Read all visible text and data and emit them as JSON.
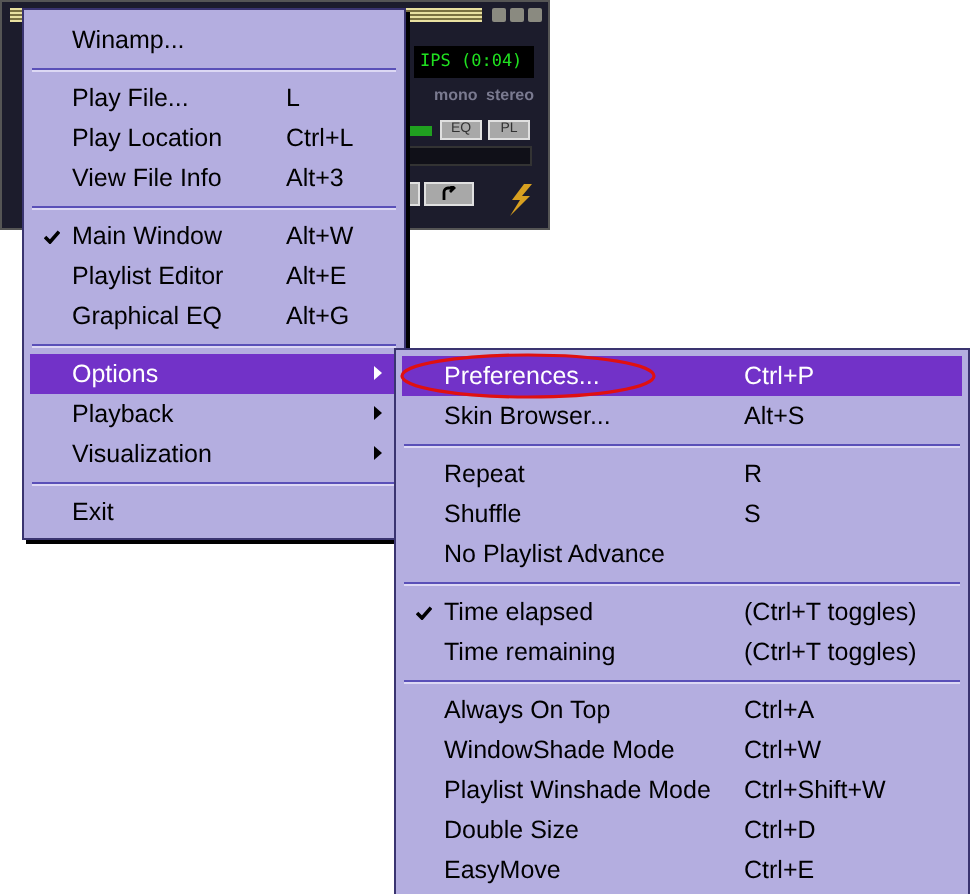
{
  "player": {
    "display": "IPS (0:04)",
    "mono": "mono",
    "stereo": "stereo",
    "eq_button": "EQ",
    "pl_button": "PL"
  },
  "menu": {
    "items": [
      {
        "kind": "item",
        "label": "Winamp...",
        "checked": false,
        "selected": false
      },
      {
        "kind": "separator"
      },
      {
        "kind": "item",
        "label": "Play File...",
        "shortcut": "L",
        "checked": false,
        "selected": false
      },
      {
        "kind": "item",
        "label": "Play Location",
        "shortcut": "Ctrl+L",
        "checked": false,
        "selected": false
      },
      {
        "kind": "item",
        "label": "View File Info",
        "shortcut": "Alt+3",
        "checked": false,
        "selected": false
      },
      {
        "kind": "separator"
      },
      {
        "kind": "item",
        "label": "Main Window",
        "shortcut": "Alt+W",
        "checked": true,
        "selected": false
      },
      {
        "kind": "item",
        "label": "Playlist Editor",
        "shortcut": "Alt+E",
        "checked": false,
        "selected": false
      },
      {
        "kind": "item",
        "label": "Graphical EQ",
        "shortcut": "Alt+G",
        "checked": false,
        "selected": false
      },
      {
        "kind": "separator"
      },
      {
        "kind": "submenu",
        "label": "Options",
        "checked": false,
        "selected": true
      },
      {
        "kind": "submenu",
        "label": "Playback",
        "checked": false,
        "selected": false
      },
      {
        "kind": "submenu",
        "label": "Visualization",
        "checked": false,
        "selected": false
      },
      {
        "kind": "separator"
      },
      {
        "kind": "item",
        "label": "Exit",
        "checked": false,
        "selected": false
      }
    ]
  },
  "submenu": {
    "items": [
      {
        "kind": "item",
        "label": "Preferences...",
        "shortcut": "Ctrl+P",
        "checked": false,
        "selected": true,
        "circled": true
      },
      {
        "kind": "item",
        "label": "Skin Browser...",
        "shortcut": "Alt+S",
        "checked": false,
        "selected": false,
        "circled": false
      },
      {
        "kind": "separator"
      },
      {
        "kind": "item",
        "label": "Repeat",
        "shortcut": "R",
        "checked": false,
        "selected": false,
        "circled": false
      },
      {
        "kind": "item",
        "label": "Shuffle",
        "shortcut": "S",
        "checked": false,
        "selected": false,
        "circled": false
      },
      {
        "kind": "item",
        "label": "No Playlist Advance",
        "checked": false,
        "selected": false,
        "circled": false
      },
      {
        "kind": "separator"
      },
      {
        "kind": "item",
        "label": "Time elapsed",
        "shortcut": "(Ctrl+T toggles)",
        "checked": true,
        "selected": false,
        "circled": false
      },
      {
        "kind": "item",
        "label": "Time remaining",
        "shortcut": "(Ctrl+T toggles)",
        "checked": false,
        "selected": false,
        "circled": false
      },
      {
        "kind": "separator"
      },
      {
        "kind": "item",
        "label": "Always On Top",
        "shortcut": "Ctrl+A",
        "checked": false,
        "selected": false,
        "circled": false
      },
      {
        "kind": "item",
        "label": "WindowShade Mode",
        "shortcut": "Ctrl+W",
        "checked": false,
        "selected": false,
        "circled": false
      },
      {
        "kind": "item",
        "label": "Playlist Winshade Mode",
        "shortcut": "Ctrl+Shift+W",
        "checked": false,
        "selected": false,
        "circled": false
      },
      {
        "kind": "item",
        "label": "Double Size",
        "shortcut": "Ctrl+D",
        "checked": false,
        "selected": false,
        "circled": false
      },
      {
        "kind": "item",
        "label": "EasyMove",
        "shortcut": "Ctrl+E",
        "checked": false,
        "selected": false,
        "circled": false
      }
    ]
  }
}
